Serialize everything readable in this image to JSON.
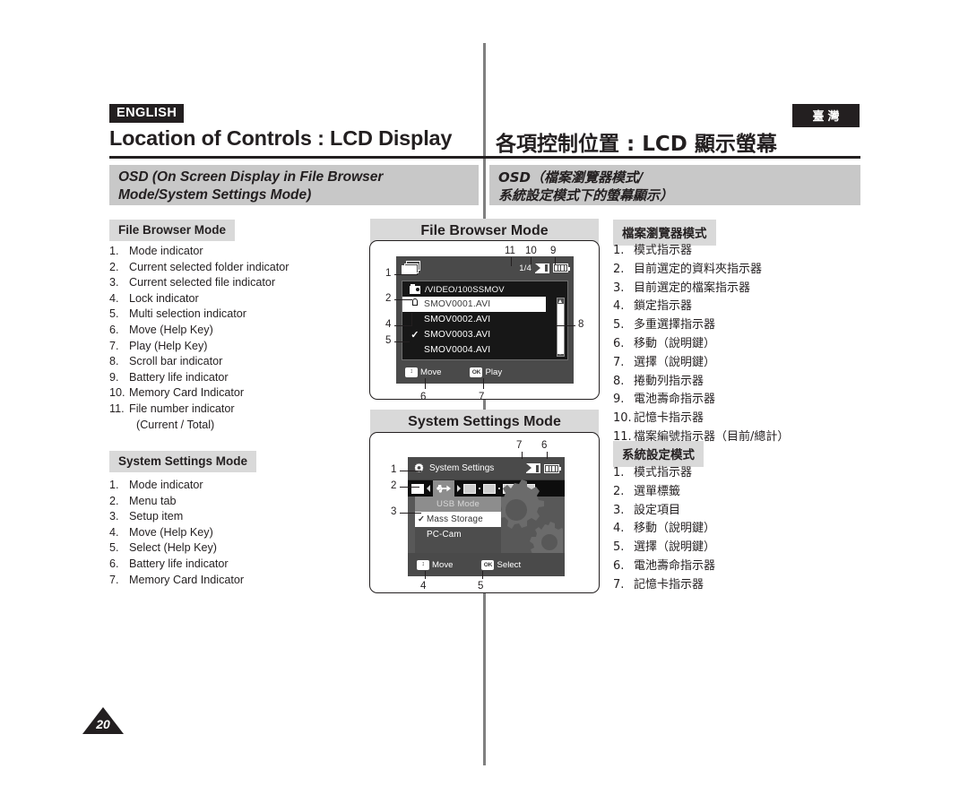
{
  "header": {
    "lang_en": "ENGLISH",
    "lang_zh": "臺灣",
    "title_en": "Location of Controls : LCD Display",
    "title_zh": "各項控制位置 : LCD 顯示螢幕",
    "osd_band_en_line1": "OSD (On Screen Display in File Browser",
    "osd_band_en_line2": "Mode/System Settings Mode)",
    "osd_band_zh_line1": "OSD（檔案瀏覽器模式/",
    "osd_band_zh_line2": "系統設定模式下的螢幕顯示）"
  },
  "left": {
    "file_browser": {
      "heading": "File Browser Mode",
      "items": [
        {
          "n": "1.",
          "label": "Mode indicator"
        },
        {
          "n": "2.",
          "label": "Current selected folder indicator"
        },
        {
          "n": "3.",
          "label": "Current selected file indicator"
        },
        {
          "n": "4.",
          "label": "Lock indicator"
        },
        {
          "n": "5.",
          "label": "Multi selection indicator"
        },
        {
          "n": "6.",
          "label": "Move (Help Key)"
        },
        {
          "n": "7.",
          "label": "Play (Help Key)"
        },
        {
          "n": "8.",
          "label": "Scroll bar indicator"
        },
        {
          "n": "9.",
          "label": "Battery life indicator"
        },
        {
          "n": "10.",
          "label": "Memory Card Indicator"
        },
        {
          "n": "11.",
          "label": "File number indicator"
        }
      ],
      "item11_continuation": "(Current / Total)"
    },
    "system_settings": {
      "heading": "System Settings Mode",
      "items": [
        {
          "n": "1.",
          "label": "Mode indicator"
        },
        {
          "n": "2.",
          "label": "Menu tab"
        },
        {
          "n": "3.",
          "label": "Setup item"
        },
        {
          "n": "4.",
          "label": "Move (Help Key)"
        },
        {
          "n": "5.",
          "label": "Select (Help Key)"
        },
        {
          "n": "6.",
          "label": "Battery life indicator"
        },
        {
          "n": "7.",
          "label": "Memory Card Indicator"
        }
      ]
    }
  },
  "right": {
    "file_browser": {
      "heading": "檔案瀏覽器模式",
      "items": [
        {
          "n": "1.",
          "label": "模式指示器"
        },
        {
          "n": "2.",
          "label": "目前選定的資料夾指示器"
        },
        {
          "n": "3.",
          "label": "目前選定的檔案指示器"
        },
        {
          "n": "4.",
          "label": "鎖定指示器"
        },
        {
          "n": "5.",
          "label": "多重選擇指示器"
        },
        {
          "n": "6.",
          "label": "移動（說明鍵）"
        },
        {
          "n": "7.",
          "label": "選擇（說明鍵）"
        },
        {
          "n": "8.",
          "label": "捲動列指示器"
        },
        {
          "n": "9.",
          "label": "電池壽命指示器"
        },
        {
          "n": "10.",
          "label": "記憶卡指示器"
        },
        {
          "n": "11.",
          "label": "檔案編號指示器（目前/總計）"
        }
      ]
    },
    "system_settings": {
      "heading": "系統設定模式",
      "items": [
        {
          "n": "1.",
          "label": "模式指示器"
        },
        {
          "n": "2.",
          "label": "選單標籤"
        },
        {
          "n": "3.",
          "label": "設定項目"
        },
        {
          "n": "4.",
          "label": "移動（說明鍵）"
        },
        {
          "n": "5.",
          "label": "選擇（說明鍵）"
        },
        {
          "n": "6.",
          "label": "電池壽命指示器"
        },
        {
          "n": "7.",
          "label": "記憶卡指示器"
        }
      ]
    }
  },
  "diagram_file_browser": {
    "caption": "File Browser Mode",
    "file_count": "1/4",
    "path": "/VIDEO/100SSMOV",
    "files": [
      {
        "name": "SMOV0001.AVI",
        "mark": "lock",
        "selected": true
      },
      {
        "name": "SMOV0002.AVI",
        "mark": "",
        "selected": false
      },
      {
        "name": "SMOV0003.AVI",
        "mark": "check",
        "selected": false
      },
      {
        "name": "SMOV0004.AVI",
        "mark": "",
        "selected": false
      }
    ],
    "help_move_key": "↕",
    "help_move_label": "Move",
    "help_ok_key": "OK",
    "help_play_label": "Play",
    "callouts": [
      "1",
      "2",
      "4",
      "5",
      "6",
      "7",
      "8",
      "9",
      "10",
      "11"
    ]
  },
  "diagram_system_settings": {
    "caption": "System Settings Mode",
    "title": "System Settings",
    "menu_head": "USB Mode",
    "options": [
      {
        "label": "Mass Storage",
        "selected": true,
        "checked": true
      },
      {
        "label": "PC-Cam",
        "selected": false,
        "checked": false
      }
    ],
    "help_move_key": "↕",
    "help_move_label": "Move",
    "help_ok_key": "OK",
    "help_select_label": "Select",
    "callouts": [
      "1",
      "2",
      "3",
      "4",
      "5",
      "6",
      "7"
    ]
  },
  "footer": {
    "page_number": "20"
  },
  "colors": {
    "accent_dark": "#231f20",
    "band_gray": "#c8c8c8",
    "chip_gray": "#d9d9d9",
    "lcd_bg": "#4a4a4a",
    "lcd_list_bg": "#171717"
  }
}
